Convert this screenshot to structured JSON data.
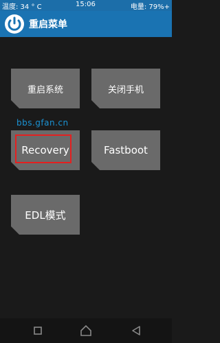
{
  "status_bar": {
    "temperature": "温度: 34 ° C",
    "time": "15:06",
    "battery": "电量: 79%+"
  },
  "header": {
    "title": "重启菜单"
  },
  "menu": {
    "reboot_system": "重启系统",
    "power_off": "关闭手机",
    "recovery": "Recovery",
    "fastboot": "Fastboot",
    "edl": "EDL模式"
  },
  "watermark": "bbs.gfan.cn",
  "colors": {
    "header_bg": "#1a73b2",
    "status_bg": "#1c6ea9",
    "tile_bg": "#6a6a6a",
    "highlight": "#e52020"
  },
  "icons": {
    "logo": "twrp-logo-icon",
    "recent": "recent-apps-icon",
    "home": "home-icon",
    "back": "back-icon"
  }
}
